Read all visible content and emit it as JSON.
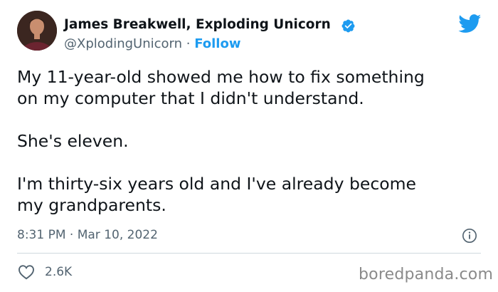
{
  "author": {
    "display_name": "James Breakwell, Exploding Unicorn",
    "handle": "@XplodingUnicorn",
    "separator": " · ",
    "follow_label": "Follow"
  },
  "tweet": {
    "text": "My 11-year-old showed me how to fix something\non my computer that I didn't understand.\n\nShe's eleven.\n\nI'm thirty-six years old and I've already become\nmy grandparents.",
    "timestamp": "8:31 PM · Mar 10, 2022",
    "likes": "2.6K"
  },
  "watermark": "boredpanda.com",
  "icons": {
    "verified": "verified-badge-icon",
    "brand": "twitter-bird-icon",
    "info": "info-icon",
    "like": "heart-icon"
  },
  "colors": {
    "accent": "#1d9bf0",
    "text": "#0f1419",
    "secondary": "#536471",
    "divider": "#cfd9de"
  }
}
